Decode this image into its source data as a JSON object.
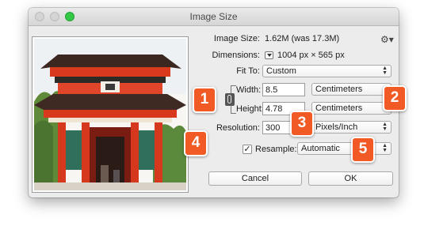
{
  "window": {
    "title": "Image Size"
  },
  "image_size": {
    "label": "Image Size:",
    "value": "1.62M (was 17.3M)"
  },
  "dimensions": {
    "label": "Dimensions:",
    "value": "1004 px  ×  565 px"
  },
  "fit_to": {
    "label": "Fit To:",
    "selected": "Custom"
  },
  "width": {
    "label": "Width:",
    "value": "8.5",
    "unit": "Centimeters"
  },
  "height": {
    "label": "Height:",
    "value": "4.78",
    "unit": "Centimeters"
  },
  "resolution": {
    "label": "Resolution:",
    "value": "300",
    "unit": "Pixels/Inch"
  },
  "resample": {
    "label": "Resample:",
    "checked": true,
    "checkmark": "✓",
    "selected": "Automatic"
  },
  "buttons": {
    "cancel": "Cancel",
    "ok": "OK"
  },
  "icons": {
    "gear": "gear-icon",
    "link": "link-chain-icon",
    "disclosure": "disclosure-icon"
  },
  "callouts": [
    "1",
    "2",
    "3",
    "4",
    "5"
  ],
  "colors": {
    "callout": "#f15a24",
    "traffic_light_green": "#34c748",
    "window_bg": "#ececec"
  }
}
